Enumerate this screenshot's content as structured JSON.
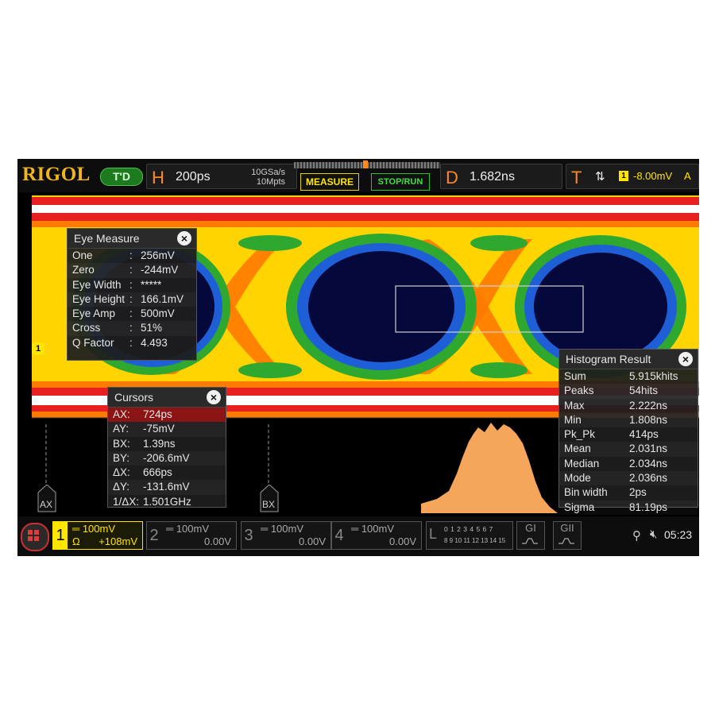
{
  "topbar": {
    "brand": "RIGOL",
    "mode_badge": "T'D",
    "horizontal": {
      "letter": "H",
      "timebase": "200ps",
      "sample_rate": "10GSa/s",
      "memory_depth": "10Mpts"
    },
    "measure_button": "MEASURE",
    "stoprun_button": "STOP/RUN",
    "delay": {
      "letter": "D",
      "value": "1.682ns"
    },
    "trigger": {
      "letter": "T",
      "edge_icon": "rising-falling-edge-icon",
      "source": "1",
      "level": "-8.00mV",
      "mode": "A"
    }
  },
  "eye_measure": {
    "title": "Eye Measure",
    "rows": [
      {
        "label": "One",
        "sep": ":",
        "value": "256mV"
      },
      {
        "label": "Zero",
        "sep": ":",
        "value": "-244mV"
      },
      {
        "label": "Eye Width",
        "sep": ":",
        "value": "*****"
      },
      {
        "label": "Eye Height",
        "sep": ":",
        "value": "166.1mV"
      },
      {
        "label": "Eye Amp",
        "sep": ":",
        "value": "500mV"
      },
      {
        "label": "Cross",
        "sep": ":",
        "value": "51%"
      },
      {
        "label": "Q Factor",
        "sep": ":",
        "value": "4.493"
      }
    ]
  },
  "cursors": {
    "title": "Cursors",
    "rows": [
      {
        "label": "AX:",
        "value": "724ps"
      },
      {
        "label": "AY:",
        "value": "-75mV"
      },
      {
        "label": "BX:",
        "value": "1.39ns"
      },
      {
        "label": "BY:",
        "value": "-206.6mV"
      },
      {
        "label": "ΔX:",
        "value": "666ps"
      },
      {
        "label": "ΔY:",
        "value": "-131.6mV"
      },
      {
        "label": "1/ΔX:",
        "value": "1.501GHz"
      }
    ],
    "marker_a": "AX",
    "marker_b": "BX"
  },
  "histogram": {
    "title": "Histogram Result",
    "rows": [
      {
        "label": "Sum",
        "value": "5.915khits"
      },
      {
        "label": "Peaks",
        "value": "54hits"
      },
      {
        "label": "Max",
        "value": "2.222ns"
      },
      {
        "label": "Min",
        "value": "1.808ns"
      },
      {
        "label": "Pk_Pk",
        "value": "414ps"
      },
      {
        "label": "Mean",
        "value": "2.031ns"
      },
      {
        "label": "Median",
        "value": "2.034ns"
      },
      {
        "label": "Mode",
        "value": "2.036ns"
      },
      {
        "label": "Bin width",
        "value": "2ps"
      },
      {
        "label": "Sigma",
        "value": "81.19ps"
      }
    ],
    "color": "#f5a65b"
  },
  "channel_marker": "1",
  "channels": [
    {
      "num": "1",
      "scale": "100mV",
      "coupling": "Ω",
      "offset": "+108mV",
      "active": true
    },
    {
      "num": "2",
      "scale": "100mV",
      "offset": "0.00V"
    },
    {
      "num": "3",
      "scale": "100mV",
      "offset": "0.00V"
    },
    {
      "num": "4",
      "scale": "100mV",
      "offset": "0.00V"
    }
  ],
  "logic": {
    "letter": "L",
    "row1": "0 1 2 3  4 5 6 7",
    "row2": "8 9 10 11 12 13 14 15"
  },
  "bus_buttons": [
    {
      "label": "GI"
    },
    {
      "label": "GII"
    }
  ],
  "status": {
    "usb_icon": "usb-icon",
    "speaker_icon": "speaker-muted-icon",
    "time": "05:23"
  },
  "colors": {
    "brand": "#f2b61c",
    "ch1": "#ffe600",
    "accent_orange": "#ff8a1e",
    "run_green": "#3fe03f"
  }
}
